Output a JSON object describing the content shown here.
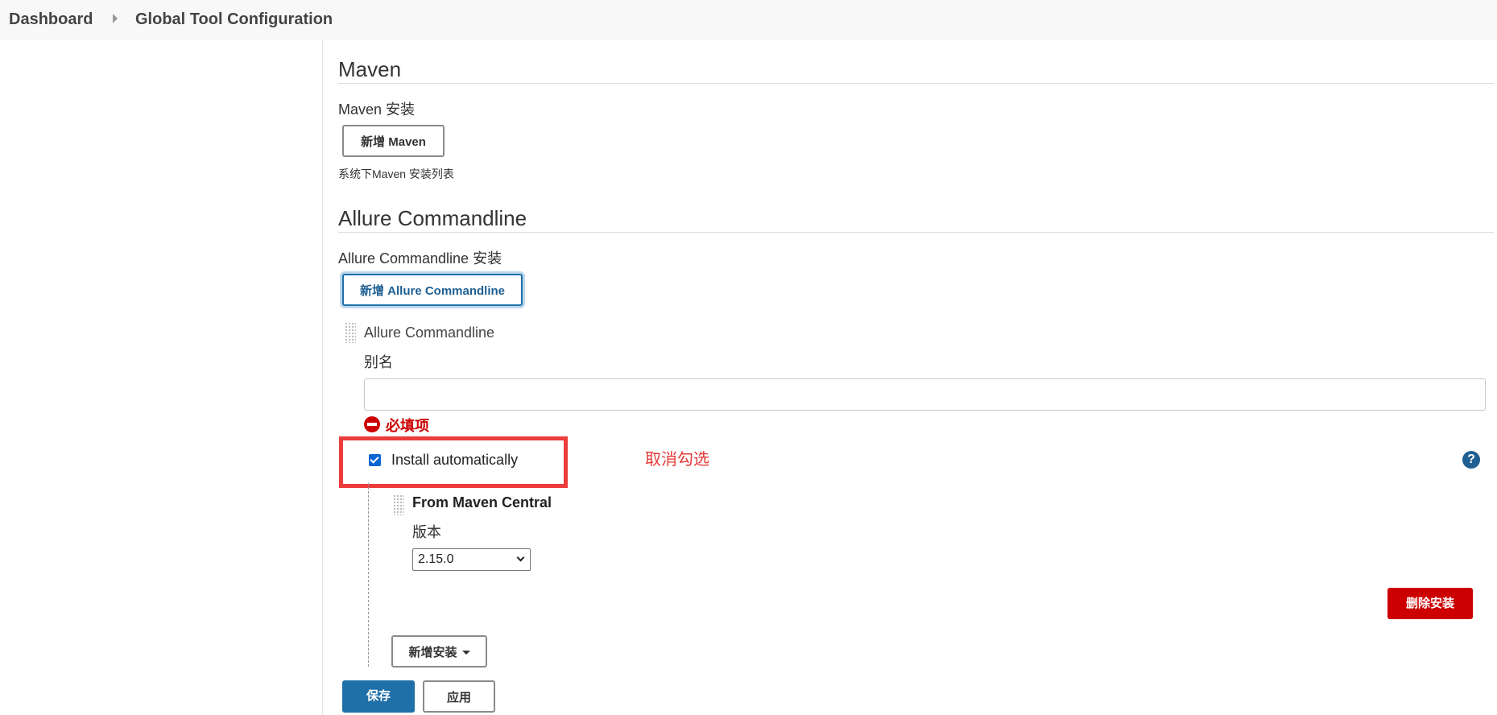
{
  "breadcrumb": {
    "home": "Dashboard",
    "current": "Global Tool Configuration"
  },
  "maven": {
    "section_title": "Maven",
    "install_label": "Maven 安装",
    "add_button": "新增 Maven",
    "help_text": "系统下Maven 安装列表"
  },
  "allure": {
    "section_title": "Allure Commandline",
    "install_label": "Allure Commandline 安装",
    "add_button": "新增 Allure Commandline",
    "item_title": "Allure Commandline",
    "alias_label": "别名",
    "alias_value": "",
    "required_error": "必填项",
    "install_auto_label": "Install automatically",
    "install_auto_checked": true,
    "annotation": "取消勾选",
    "help_icon": "?",
    "installer": {
      "title": "From Maven Central",
      "version_label": "版本",
      "version_value": "2.15.0"
    },
    "delete_button": "删除安装",
    "add_installer_button": "新增安装"
  },
  "footer": {
    "save_button": "保存",
    "apply_button": "应用"
  },
  "colors": {
    "primary": "#1f6fa8",
    "danger": "#cc0000",
    "annotation": "#e53935"
  },
  "icons": [
    "chevron-right-icon",
    "drag-handle-icon",
    "error-icon",
    "help-icon",
    "chevron-down-icon",
    "caret-down-icon"
  ]
}
